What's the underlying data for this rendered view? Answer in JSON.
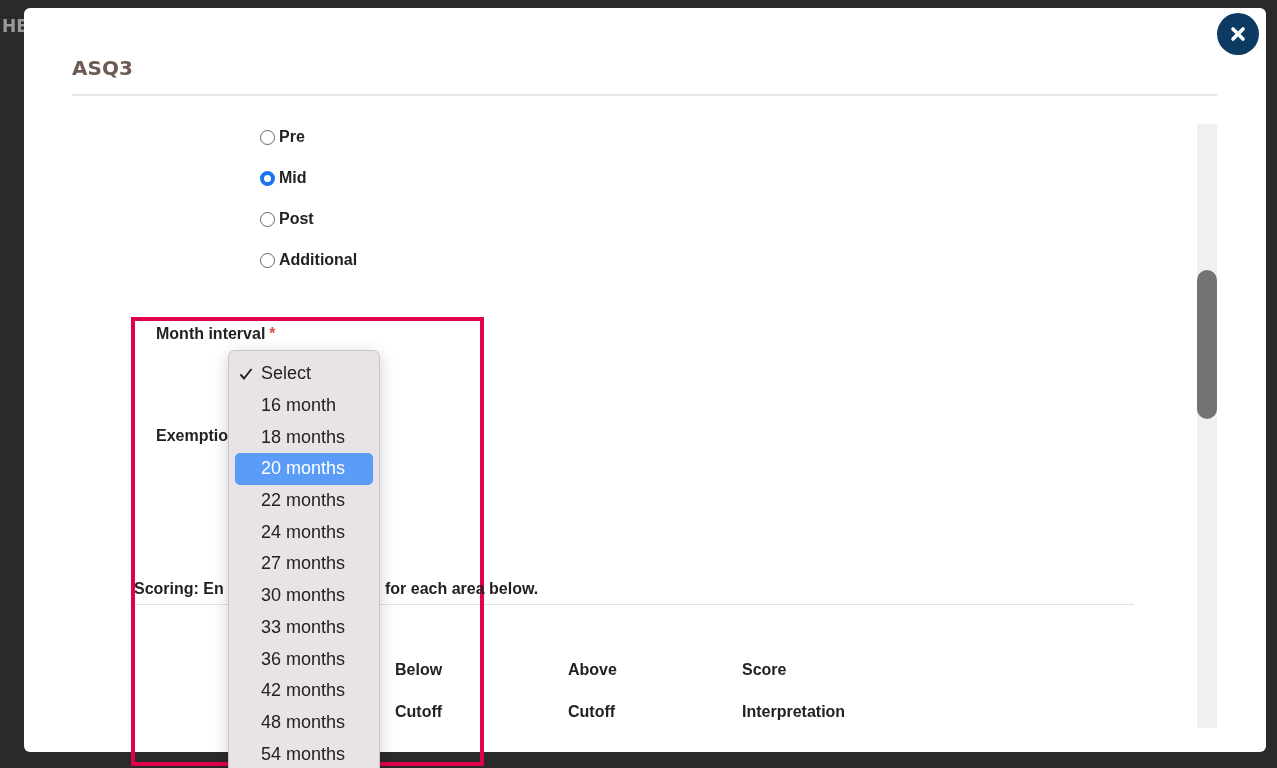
{
  "backdrop_text": "HE",
  "dialog": {
    "title": "ASQ3"
  },
  "timing_options": [
    {
      "label": "Pre",
      "selected": false
    },
    {
      "label": "Mid",
      "selected": true
    },
    {
      "label": "Post",
      "selected": false
    },
    {
      "label": "Additional",
      "selected": false
    }
  ],
  "month_interval": {
    "label": "Month interval",
    "required_mark": "*"
  },
  "exemption": {
    "label": "Exemptio"
  },
  "scoring": {
    "text_before": "Scoring: En",
    "text_after": "for each area below."
  },
  "score_table": {
    "columns": [
      {
        "line_1": "Below",
        "line_2": "Cutoff"
      },
      {
        "line_1": "Above",
        "line_2": "Cutoff"
      },
      {
        "line_1": "Score",
        "line_2": "Interpretation"
      }
    ]
  },
  "month_dropdown": {
    "options": [
      {
        "label": "Select",
        "checked": true,
        "selected": false
      },
      {
        "label": "16 month",
        "checked": false,
        "selected": false
      },
      {
        "label": "18 months",
        "checked": false,
        "selected": false
      },
      {
        "label": "20 months",
        "checked": false,
        "selected": true
      },
      {
        "label": "22 months",
        "checked": false,
        "selected": false
      },
      {
        "label": "24 months",
        "checked": false,
        "selected": false
      },
      {
        "label": "27 months",
        "checked": false,
        "selected": false
      },
      {
        "label": "30 months",
        "checked": false,
        "selected": false
      },
      {
        "label": "33 months",
        "checked": false,
        "selected": false
      },
      {
        "label": "36 months",
        "checked": false,
        "selected": false
      },
      {
        "label": "42 months",
        "checked": false,
        "selected": false
      },
      {
        "label": "48 months",
        "checked": false,
        "selected": false
      },
      {
        "label": "54 months",
        "checked": false,
        "selected": false
      }
    ]
  }
}
